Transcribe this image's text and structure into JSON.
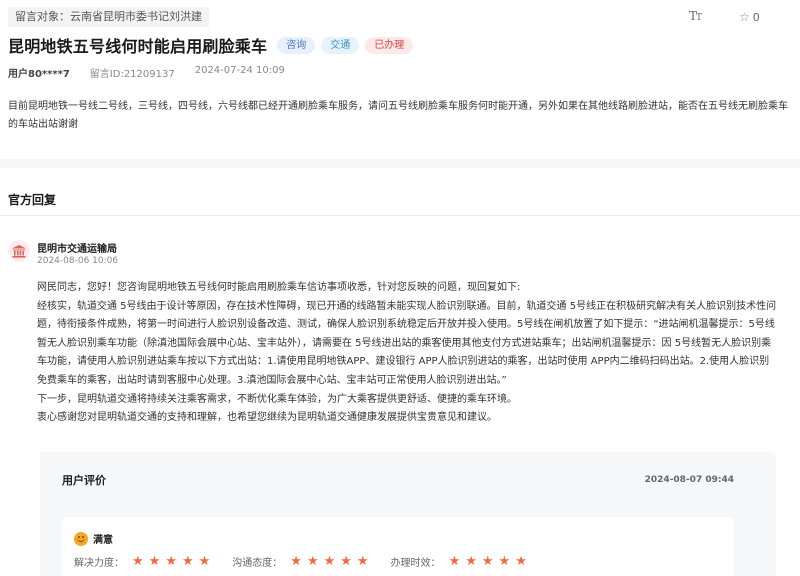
{
  "header": {
    "recipient": "留言对象：云南省昆明市委书记刘洪建",
    "favorite_count": "0",
    "font_size_icon": "font-size-icon",
    "star_icon": "star-outline-icon"
  },
  "message": {
    "title": "昆明地铁五号线何时能启用刷脸乘车",
    "tags": [
      "咨询",
      "交通",
      "已办理"
    ],
    "user": "用户80****7",
    "message_id": "留言ID:21209137",
    "date": "2024-07-24 10:09",
    "content": "目前昆明地铁一号线二号线，三号线，四号线，六号线都已经开通刷脸乘车服务，请问五号线刷脸乘车服务何时能开通，另外如果在其他线路刷脸进站，能否在五号线无刷脸乘车的车站出站谢谢"
  },
  "official_reply": {
    "section_title": "官方回复",
    "department": "昆明市交通运输局",
    "time": "2024-08-06 10:06",
    "paragraphs": [
      "网民同志，您好！您咨询昆明地铁五号线何时能启用刷脸乘车信访事项收悉，针对您反映的问题，现回复如下:",
      "经核实，轨道交通 5号线由于设计等原因，存在技术性障碍，现已开通的线路暂未能实现人脸识别联通。目前，轨道交通 5号线正在积极研究解决有关人脸识别技术性问题，待衔接条件成熟，将第一时间进行人脸识别设备改造、测试，确保人脸识别系统稳定后开放并投入使用。5号线在闸机放置了如下提示：“进站闸机温馨提示：5号线暂无人脸识别乘车功能（除滇池国际会展中心站、宝丰站外），请需要在 5号线进出站的乘客使用其他支付方式进站乘车；出站闸机温馨提示：因 5号线暂无人脸识别乘车功能，请使用人脸识别进站乘车按以下方式出站：1.请使用昆明地铁APP、建设银行 APP人脸识别进站的乘客，出站时使用 APP内二维码扫码出站。2.使用人脸识别免费乘车的乘客，出站时请到客服中心处理。3.滇池国际会展中心站、宝丰站可正常使用人脸识别进出站。”",
      "下一步，昆明轨道交通将持续关注乘客需求，不断优化乘车体验，为广大乘客提供更舒适、便捷的乘车环境。",
      "衷心感谢您对昆明轨道交通的支持和理解，也希望您继续为昆明轨道交通健康发展提供宝贵意见和建议。"
    ]
  },
  "user_rating": {
    "title": "用户评价",
    "time": "2024-08-07 09:44",
    "overall": "满意",
    "scores": [
      {
        "label": "解决力度：",
        "stars": 5
      },
      {
        "label": "沟通态度：",
        "stars": 5
      },
      {
        "label": "办理时效：",
        "stars": 5
      }
    ],
    "star_color": "#f26b3a"
  }
}
